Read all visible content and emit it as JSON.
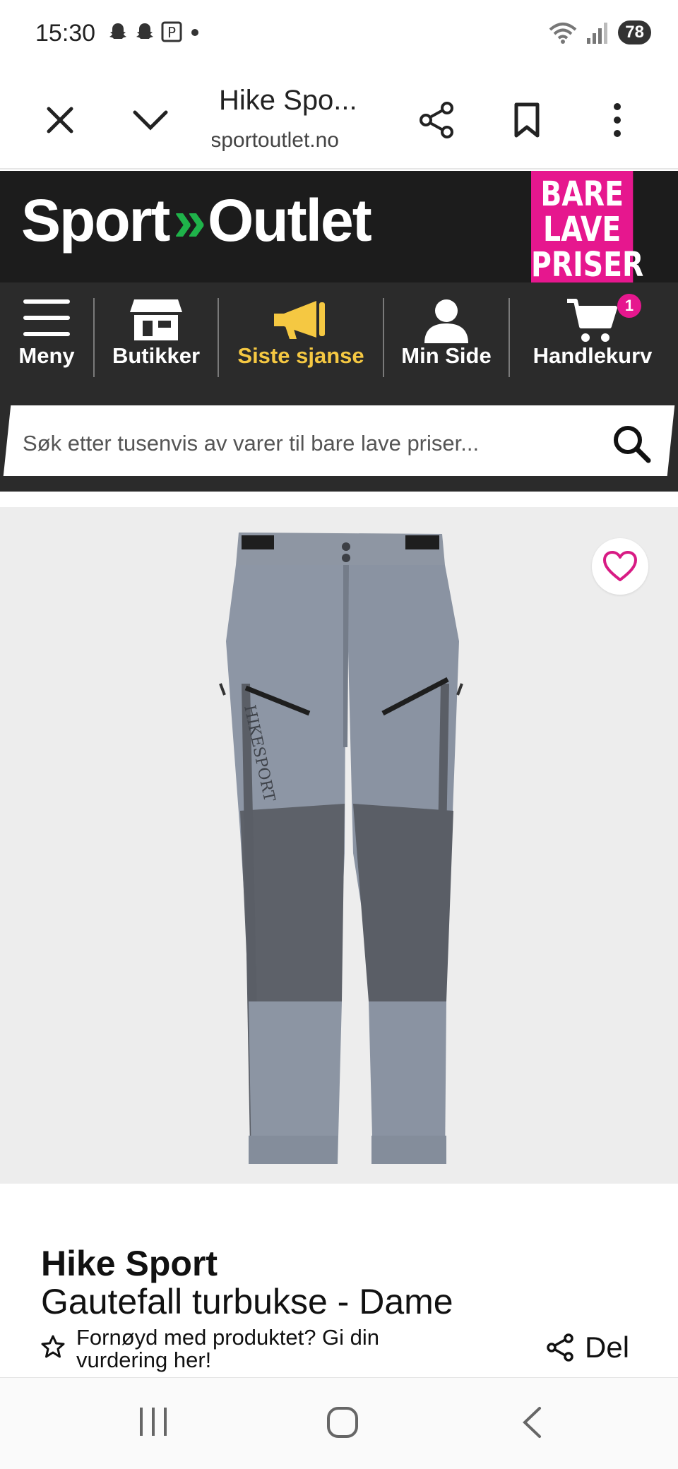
{
  "status_bar": {
    "time": "15:30",
    "notification_icons": [
      "snapchat-icon",
      "snapchat-icon",
      "parking-icon",
      "dot-icon"
    ],
    "battery": "78"
  },
  "browser": {
    "title": "Hike Spo...",
    "url": "sportoutlet.no",
    "buttons": [
      "close-icon",
      "chevron-down-icon",
      "share-icon",
      "bookmark-icon",
      "more-vert-icon"
    ]
  },
  "site": {
    "logo_left": "Sport",
    "logo_arrows": "»",
    "logo_right": "Outlet",
    "badge_lines": [
      "BARE",
      "LAVE",
      "PRISER"
    ],
    "brand_color": "#1fb34a",
    "badge_color": "#e6178e"
  },
  "nav": {
    "items": [
      {
        "label": "Meny",
        "icon": "menu-icon"
      },
      {
        "label": "Butikker",
        "icon": "store-icon"
      },
      {
        "label": "Siste sjanse",
        "icon": "megaphone-icon"
      },
      {
        "label": "Min Side",
        "icon": "user-icon"
      },
      {
        "label": "Handlekurv",
        "icon": "cart-icon"
      }
    ],
    "cart_count": "1",
    "active_color": "#f5c842"
  },
  "search": {
    "placeholder": "Søk etter tusenvis av varer til bare lave priser..."
  },
  "product": {
    "brand": "Hike Sport",
    "name": "Gautefall turbukse - Dame",
    "rating_prompt": "Fornøyd med produktet? Gi din vurdering her!",
    "share_label": "Del",
    "image_print": "HIKESPORT"
  },
  "system_nav": [
    "recents-icon",
    "home-icon",
    "back-icon"
  ]
}
